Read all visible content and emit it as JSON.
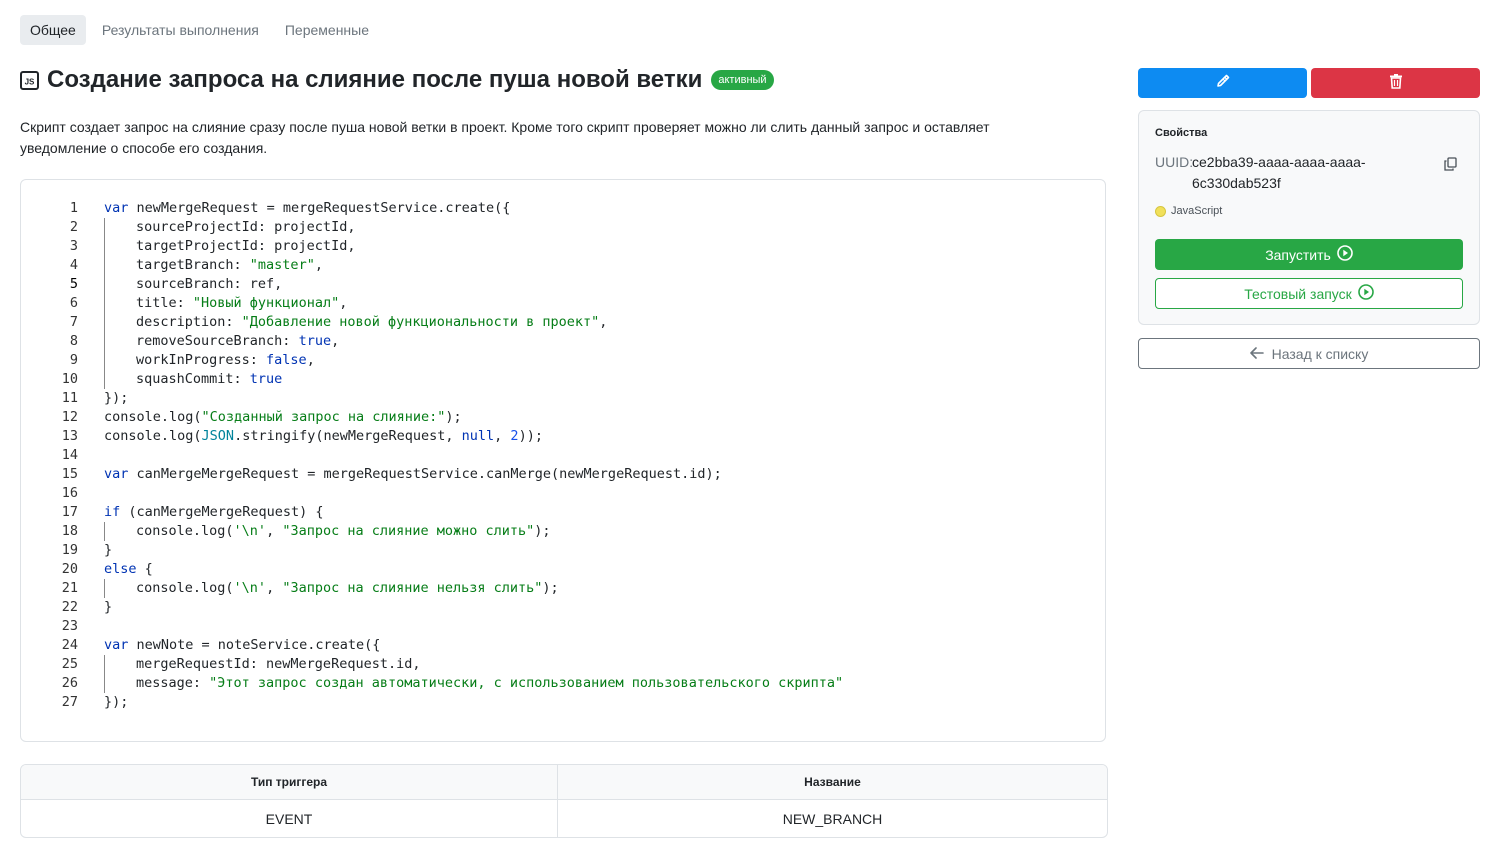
{
  "tabs": [
    {
      "label": "Общее",
      "active": true
    },
    {
      "label": "Результаты выполнения",
      "active": false
    },
    {
      "label": "Переменные",
      "active": false
    }
  ],
  "header": {
    "title": "Создание запроса на слияние после пуша новой ветки",
    "status_badge": "активный",
    "icon": "js-file-icon"
  },
  "description": "Скрипт создает запрос на слияние сразу после пуша новой ветки в проект. Кроме того скрипт проверяет можно ли слить данный запрос и оставляет уведомление о способе его создания.",
  "code": {
    "current_line": 5,
    "lines": [
      {
        "n": "1",
        "indent": 0,
        "tokens": [
          [
            "kw",
            "var"
          ],
          [
            "",
            "newMergeRequest = mergeRequestService.create({"
          ]
        ]
      },
      {
        "n": "2",
        "indent": 1,
        "tokens": [
          [
            "",
            "sourceProjectId: projectId,"
          ]
        ]
      },
      {
        "n": "3",
        "indent": 1,
        "tokens": [
          [
            "",
            "targetProjectId: projectId,"
          ]
        ]
      },
      {
        "n": "4",
        "indent": 1,
        "tokens": [
          [
            "",
            "targetBranch: "
          ],
          [
            "str",
            "\"master\""
          ],
          [
            "",
            ","
          ]
        ]
      },
      {
        "n": "5",
        "indent": 1,
        "tokens": [
          [
            "",
            "sourceBranch: ref,"
          ]
        ]
      },
      {
        "n": "6",
        "indent": 1,
        "tokens": [
          [
            "",
            "title: "
          ],
          [
            "str",
            "\"Новый функционал\""
          ],
          [
            "",
            ","
          ]
        ]
      },
      {
        "n": "7",
        "indent": 1,
        "tokens": [
          [
            "",
            "description: "
          ],
          [
            "str",
            "\"Добавление новой функциональности в проект\""
          ],
          [
            "",
            ","
          ]
        ]
      },
      {
        "n": "8",
        "indent": 1,
        "tokens": [
          [
            "",
            "removeSourceBranch: "
          ],
          [
            "kw",
            "true"
          ],
          [
            "",
            ","
          ]
        ]
      },
      {
        "n": "9",
        "indent": 1,
        "tokens": [
          [
            "",
            "workInProgress: "
          ],
          [
            "kw",
            "false"
          ],
          [
            "",
            ","
          ]
        ]
      },
      {
        "n": "10",
        "indent": 1,
        "tokens": [
          [
            "",
            "squashCommit: "
          ],
          [
            "kw",
            "true"
          ]
        ]
      },
      {
        "n": "11",
        "indent": 0,
        "tokens": [
          [
            "",
            "});"
          ]
        ]
      },
      {
        "n": "12",
        "indent": 0,
        "tokens": [
          [
            "",
            "console.log("
          ],
          [
            "str",
            "\"Созданный запрос на слияние:\""
          ],
          [
            "",
            ");"
          ]
        ]
      },
      {
        "n": "13",
        "indent": 0,
        "tokens": [
          [
            "",
            "console.log("
          ],
          [
            "cls",
            "JSON"
          ],
          [
            "",
            ".stringify(newMergeRequest, "
          ],
          [
            "kw",
            "null"
          ],
          [
            "",
            ", "
          ],
          [
            "num",
            "2"
          ],
          [
            "",
            "));"
          ]
        ]
      },
      {
        "n": "14",
        "indent": 0,
        "tokens": []
      },
      {
        "n": "15",
        "indent": 0,
        "tokens": [
          [
            "kw",
            "var"
          ],
          [
            "",
            "canMergeMergeRequest = mergeRequestService.canMerge(newMergeRequest.id);"
          ]
        ]
      },
      {
        "n": "16",
        "indent": 0,
        "tokens": []
      },
      {
        "n": "17",
        "indent": 0,
        "tokens": [
          [
            "kw",
            "if"
          ],
          [
            "",
            "(canMergeMergeRequest) {"
          ]
        ]
      },
      {
        "n": "18",
        "indent": 1,
        "tokens": [
          [
            "",
            "console.log("
          ],
          [
            "str",
            "'\\n'"
          ],
          [
            "",
            ", "
          ],
          [
            "str",
            "\"Запрос на слияние можно слить\""
          ],
          [
            "",
            ");"
          ]
        ]
      },
      {
        "n": "19",
        "indent": 0,
        "tokens": [
          [
            "",
            "}"
          ]
        ]
      },
      {
        "n": "20",
        "indent": 0,
        "tokens": [
          [
            "kw",
            "else"
          ],
          [
            "",
            "{"
          ]
        ]
      },
      {
        "n": "21",
        "indent": 1,
        "tokens": [
          [
            "",
            "console.log("
          ],
          [
            "str",
            "'\\n'"
          ],
          [
            "",
            ", "
          ],
          [
            "str",
            "\"Запрос на слияние нельзя слить\""
          ],
          [
            "",
            ");"
          ]
        ]
      },
      {
        "n": "22",
        "indent": 0,
        "tokens": [
          [
            "",
            "}"
          ]
        ]
      },
      {
        "n": "23",
        "indent": 0,
        "tokens": []
      },
      {
        "n": "24",
        "indent": 0,
        "tokens": [
          [
            "kw",
            "var"
          ],
          [
            "",
            "newNote = noteService.create({"
          ]
        ]
      },
      {
        "n": "25",
        "indent": 1,
        "tokens": [
          [
            "",
            "mergeRequestId: newMergeRequest.id,"
          ]
        ]
      },
      {
        "n": "26",
        "indent": 1,
        "tokens": [
          [
            "",
            "message: "
          ],
          [
            "str",
            "\"Этот запрос создан автоматически, с использованием пользовательского скрипта\""
          ]
        ]
      },
      {
        "n": "27",
        "indent": 0,
        "tokens": [
          [
            "",
            "});"
          ]
        ]
      }
    ]
  },
  "triggers": {
    "headers": [
      "Тип триггера",
      "Название"
    ],
    "rows": [
      [
        "EVENT",
        "NEW_BRANCH"
      ]
    ]
  },
  "actions": {
    "edit_icon": "pencil-icon",
    "delete_icon": "trash-icon"
  },
  "properties": {
    "title": "Свойства",
    "uuid_label": "UUID:",
    "uuid_value": "ce2bba39-aaaa-aaaa-aaaa-6c330dab523f",
    "language": "JavaScript",
    "language_color": "#f1e05a",
    "run_label": "Запустить",
    "test_run_label": "Тестовый запуск"
  },
  "back_label": "Назад к списку",
  "colors": {
    "primary": "#0d8bf2",
    "danger": "#dc3545",
    "success": "#28a745"
  }
}
